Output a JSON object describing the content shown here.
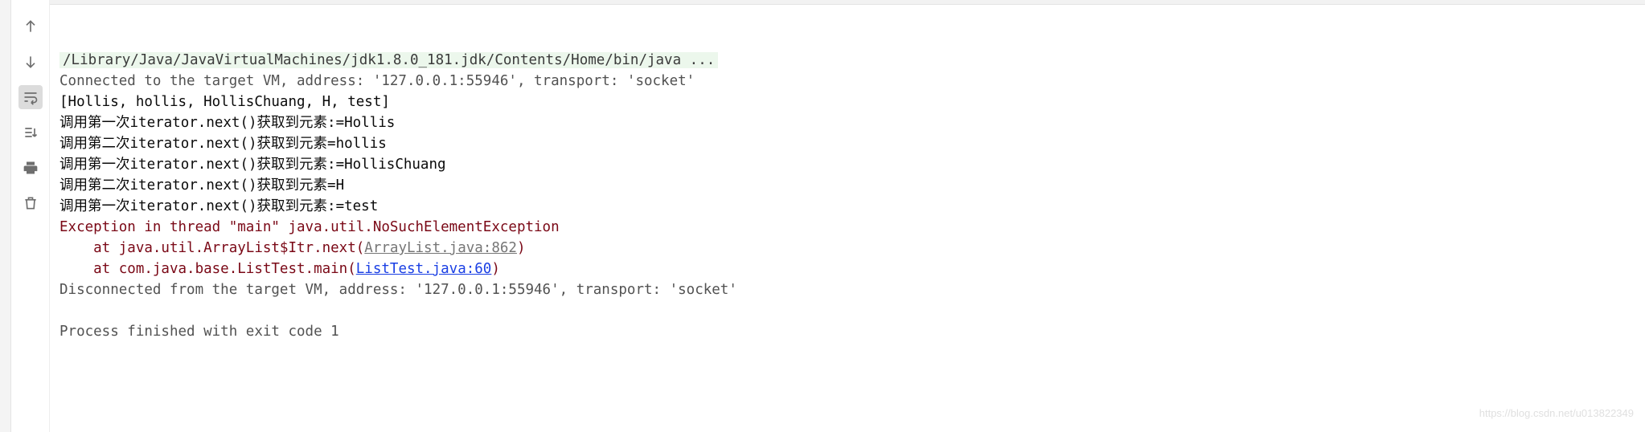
{
  "gutter": {
    "up": "scroll-up",
    "down": "scroll-down",
    "wrap": "soft-wrap",
    "scrollto": "scroll-to-end",
    "print": "print",
    "trash": "clear-all"
  },
  "console": {
    "cmd": "/Library/Java/JavaVirtualMachines/jdk1.8.0_181.jdk/Contents/Home/bin/java ...",
    "connected": "Connected to the target VM, address: '127.0.0.1:55946', transport: 'socket'",
    "list": "[Hollis, hollis, HollisChuang, H, test]",
    "calls": [
      "调用第一次iterator.next()获取到元素:=Hollis",
      "调用第二次iterator.next()获取到元素=hollis",
      "调用第一次iterator.next()获取到元素:=HollisChuang",
      "调用第二次iterator.next()获取到元素=H",
      "调用第一次iterator.next()获取到元素:=test"
    ],
    "exception": "Exception in thread \"main\" java.util.NoSuchElementException",
    "frame1_pre": "    at java.util.ArrayList$Itr.next(",
    "frame1_link": "ArrayList.java:862",
    "frame1_post": ")",
    "frame2_pre": "    at com.java.base.ListTest.main(",
    "frame2_link": "ListTest.java:60",
    "frame2_post": ")",
    "disconnected": "Disconnected from the target VM, address: '127.0.0.1:55946', transport: 'socket'",
    "exit": "Process finished with exit code 1"
  },
  "watermark": "https://blog.csdn.net/u013822349"
}
